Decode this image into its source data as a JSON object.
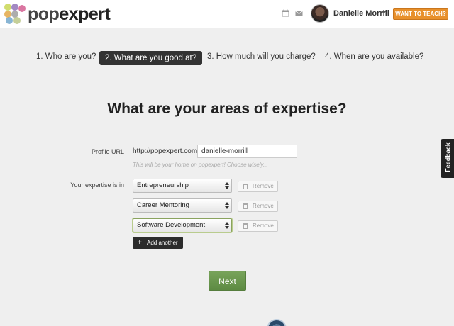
{
  "header": {
    "logo_pop": "pop",
    "logo_expert": "expert",
    "logo_dot_colors": [
      "#c6d44a",
      "#8b6bb3",
      "#d1548a",
      "#e1a33c",
      "#6aa3c9",
      "#999999",
      "#b7c37f"
    ],
    "user_name": "Danielle Morrill",
    "teach_label": "WANT TO TEACH?",
    "calendar_icon": "calendar-icon",
    "mail_icon": "mail-icon"
  },
  "steps": [
    {
      "label": "1. Who are you?",
      "active": false
    },
    {
      "label": "2. What are you good at?",
      "active": true
    },
    {
      "label": "3. How much will you charge?",
      "active": false
    },
    {
      "label": "4. When are you available?",
      "active": false
    }
  ],
  "page_title": "What are your areas of expertise?",
  "profile": {
    "label": "Profile URL",
    "prefix": "http://popexpert.com/",
    "value": "danielle-morrill",
    "hint": "This will be your home on popexpert! Choose wisely..."
  },
  "expertise": {
    "label": "Your expertise is in",
    "items": [
      {
        "value": "Entrepreneurship",
        "remove_label": "Remove"
      },
      {
        "value": "Career Mentoring",
        "remove_label": "Remove"
      },
      {
        "value": "Software Development",
        "remove_label": "Remove"
      }
    ],
    "add_label": "Add another"
  },
  "next_label": "Next",
  "feedback_label": "Feedback",
  "colors": {
    "accent_orange": "#e8902b",
    "next_green": "#6b9a4d",
    "active_step": "#333333"
  }
}
